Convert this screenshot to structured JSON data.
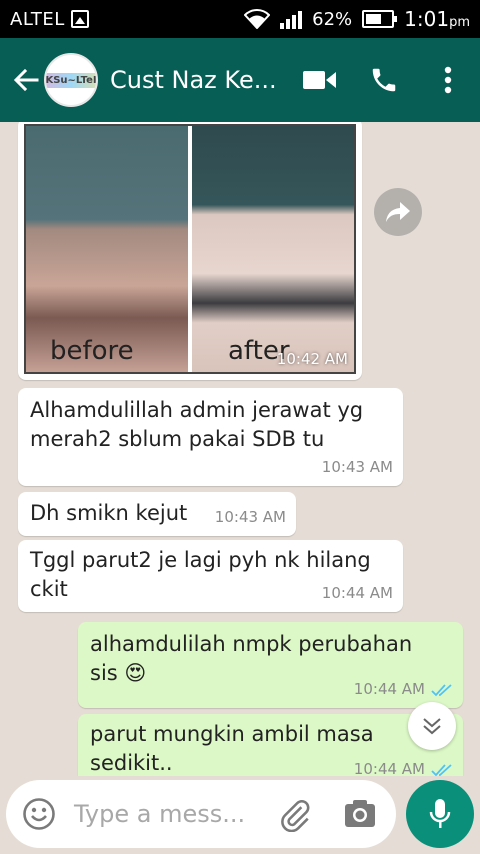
{
  "status_bar": {
    "carrier": "ALTEL",
    "battery_percent": "62%",
    "battery_level": 0.62,
    "time": "1:01",
    "time_suffix": "pm"
  },
  "header": {
    "avatar_text": "PeKSu~LTeITY",
    "title": "Cust Naz Ke..."
  },
  "messages": [
    {
      "type": "image",
      "labels": [
        "before",
        "after"
      ],
      "time": "10:42 AM"
    },
    {
      "type": "text",
      "direction": "in",
      "text": "Alhamdulillah admin jerawat yg merah2 sblum pakai SDB tu",
      "time": "10:43 AM"
    },
    {
      "type": "text",
      "direction": "in",
      "text": "Dh smikn kejut",
      "time": "10:43 AM"
    },
    {
      "type": "text",
      "direction": "in",
      "text": "Tggl parut2 je lagi pyh nk hilang ckit",
      "time": "10:44 AM"
    },
    {
      "type": "text",
      "direction": "out",
      "text": "alhamdulilah nmpk perubahan sis",
      "emoji": "😍",
      "time": "10:44 AM"
    },
    {
      "type": "text",
      "direction": "out",
      "text": "parut mungkin ambil masa sedikit..",
      "time": "10:44 AM"
    }
  ],
  "composer": {
    "placeholder": "Type a mess..."
  },
  "colors": {
    "header": "#075e54",
    "outgoing": "#dcf8c6",
    "incoming": "#ffffff",
    "mic": "#0a8f7a",
    "read_tick": "#4fc3f7"
  }
}
